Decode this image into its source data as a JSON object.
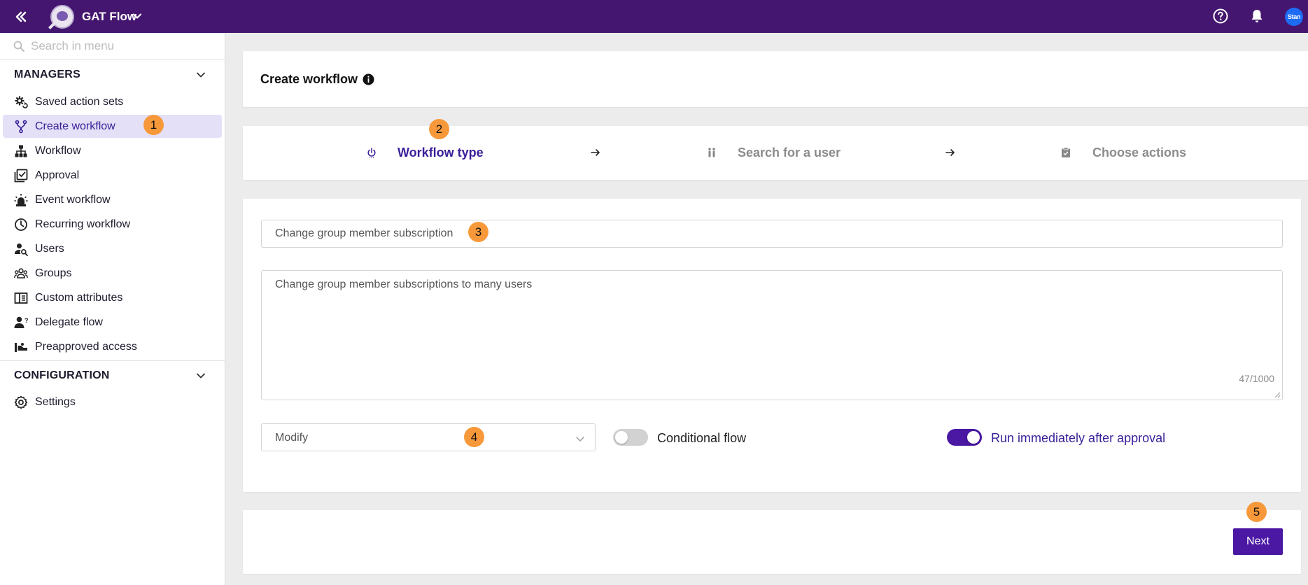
{
  "header": {
    "app_title": "GAT Flow",
    "avatar_text": "Stan",
    "icons": [
      "collapse-sidebar-icon",
      "app-logo",
      "chevron-down-icon",
      "help-icon",
      "bell-icon"
    ]
  },
  "sidebar": {
    "search_placeholder": "Search in menu",
    "sections": [
      {
        "title": "MANAGERS",
        "items": [
          {
            "label": "Saved action sets",
            "icon": "gear-sync-icon"
          },
          {
            "label": "Create workflow",
            "icon": "fork-icon",
            "active": true
          },
          {
            "label": "Workflow",
            "icon": "hierarchy-icon"
          },
          {
            "label": "Approval",
            "icon": "approval-checklist-icon"
          },
          {
            "label": "Event workflow",
            "icon": "alarm-light-icon"
          },
          {
            "label": "Recurring workflow",
            "icon": "clock-icon"
          },
          {
            "label": "Users",
            "icon": "user-search-icon"
          },
          {
            "label": "Groups",
            "icon": "groups-icon"
          },
          {
            "label": "Custom attributes",
            "icon": "book-icon"
          },
          {
            "label": "Delegate flow",
            "icon": "user-question-icon"
          },
          {
            "label": "Preapproved access",
            "icon": "preapproved-icon"
          }
        ]
      },
      {
        "title": "CONFIGURATION",
        "items": [
          {
            "label": "Settings",
            "icon": "gear-icon"
          }
        ]
      }
    ]
  },
  "main": {
    "page_title": "Create workflow",
    "steps": [
      {
        "label": "Workflow type",
        "icon": "power-icon",
        "active": true
      },
      {
        "label": "Search for a user",
        "icon": "people-icon",
        "active": false
      },
      {
        "label": "Choose actions",
        "icon": "clipboard-icon",
        "active": false
      }
    ],
    "form": {
      "name_value": "Change group member subscription",
      "description_value": "Change group member subscriptions to many users",
      "char_counter": "47/1000",
      "type_select_value": "Modify",
      "conditional_flow_label": "Conditional flow",
      "conditional_flow_on": false,
      "run_immediately_label": "Run immediately after approval",
      "run_immediately_on": true
    },
    "next_label": "Next"
  },
  "annotations": [
    "1",
    "2",
    "3",
    "4",
    "5"
  ],
  "colors": {
    "topbar": "#44166f",
    "accent": "#4a18a3",
    "active_text": "#3a1f99",
    "active_bg": "#e3e0f7",
    "badge": "#f7993a"
  }
}
